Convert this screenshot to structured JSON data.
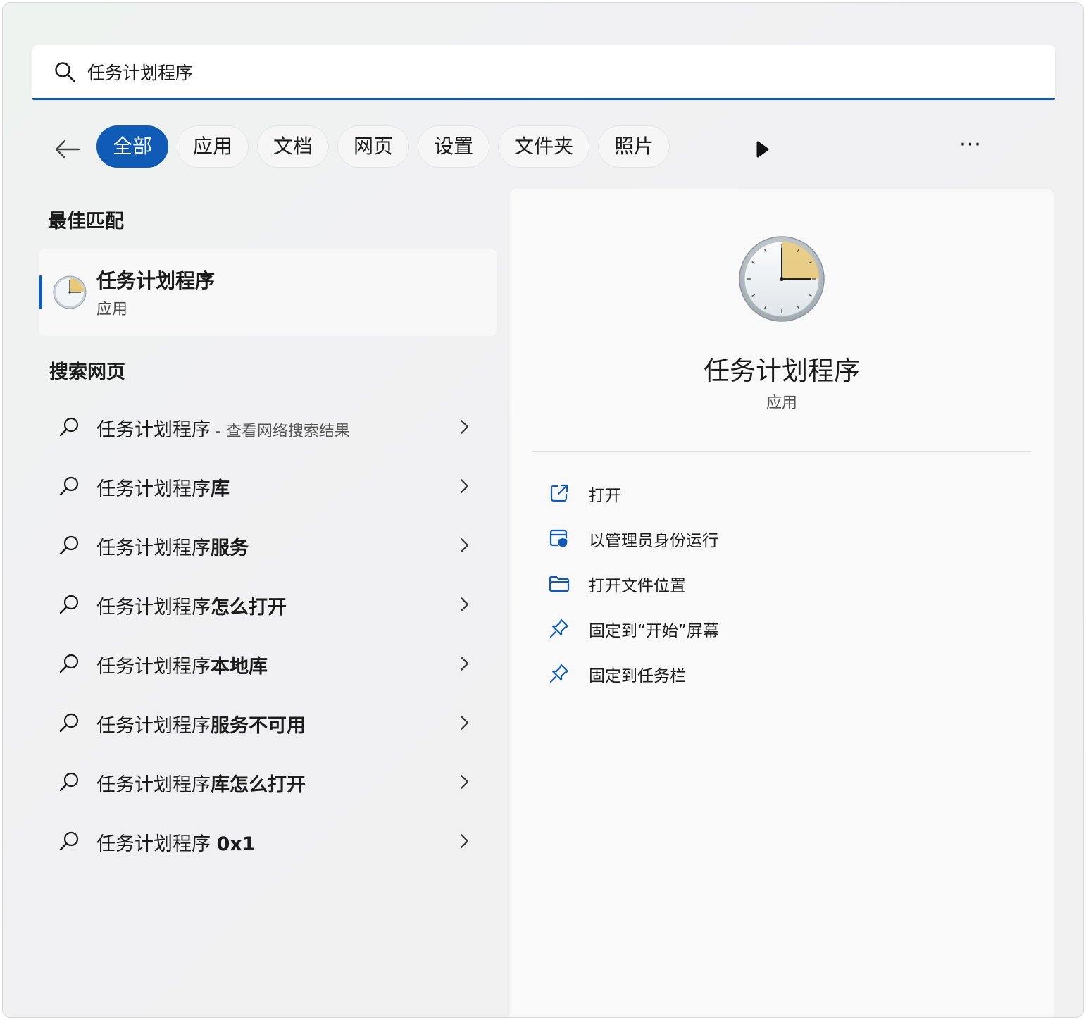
{
  "search": {
    "query": "任务计划程序"
  },
  "filters": {
    "tabs": [
      "全部",
      "应用",
      "文档",
      "网页",
      "设置",
      "文件夹",
      "照片"
    ],
    "active_index": 0,
    "more_label": "···"
  },
  "best_match": {
    "section_title": "最佳匹配",
    "name": "任务计划程序",
    "type": "应用"
  },
  "web_search": {
    "section_title": "搜索网页",
    "items": [
      {
        "prefix": "任务计划程序",
        "bold": "",
        "suffix": " - 查看网络搜索结果"
      },
      {
        "prefix": "任务计划程序",
        "bold": "库",
        "suffix": ""
      },
      {
        "prefix": "任务计划程序",
        "bold": "服务",
        "suffix": ""
      },
      {
        "prefix": "任务计划程序",
        "bold": "怎么打开",
        "suffix": ""
      },
      {
        "prefix": "任务计划程序",
        "bold": "本地库",
        "suffix": ""
      },
      {
        "prefix": "任务计划程序",
        "bold": "服务不可用",
        "suffix": ""
      },
      {
        "prefix": "任务计划程序",
        "bold": "库怎么打开",
        "suffix": ""
      },
      {
        "prefix": "任务计划程序 ",
        "bold": "0x1",
        "suffix": ""
      }
    ]
  },
  "detail": {
    "title": "任务计划程序",
    "subtitle": "应用",
    "actions": [
      {
        "label": "打开",
        "icon": "open-external-icon"
      },
      {
        "label": "以管理员身份运行",
        "icon": "shield-icon"
      },
      {
        "label": "打开文件位置",
        "icon": "folder-icon"
      },
      {
        "label": "固定到“开始”屏幕",
        "icon": "pin-icon"
      },
      {
        "label": "固定到任务栏",
        "icon": "pin-icon"
      }
    ]
  },
  "colors": {
    "accent": "#0f5bb5",
    "clock_face": "#e8c97a"
  }
}
